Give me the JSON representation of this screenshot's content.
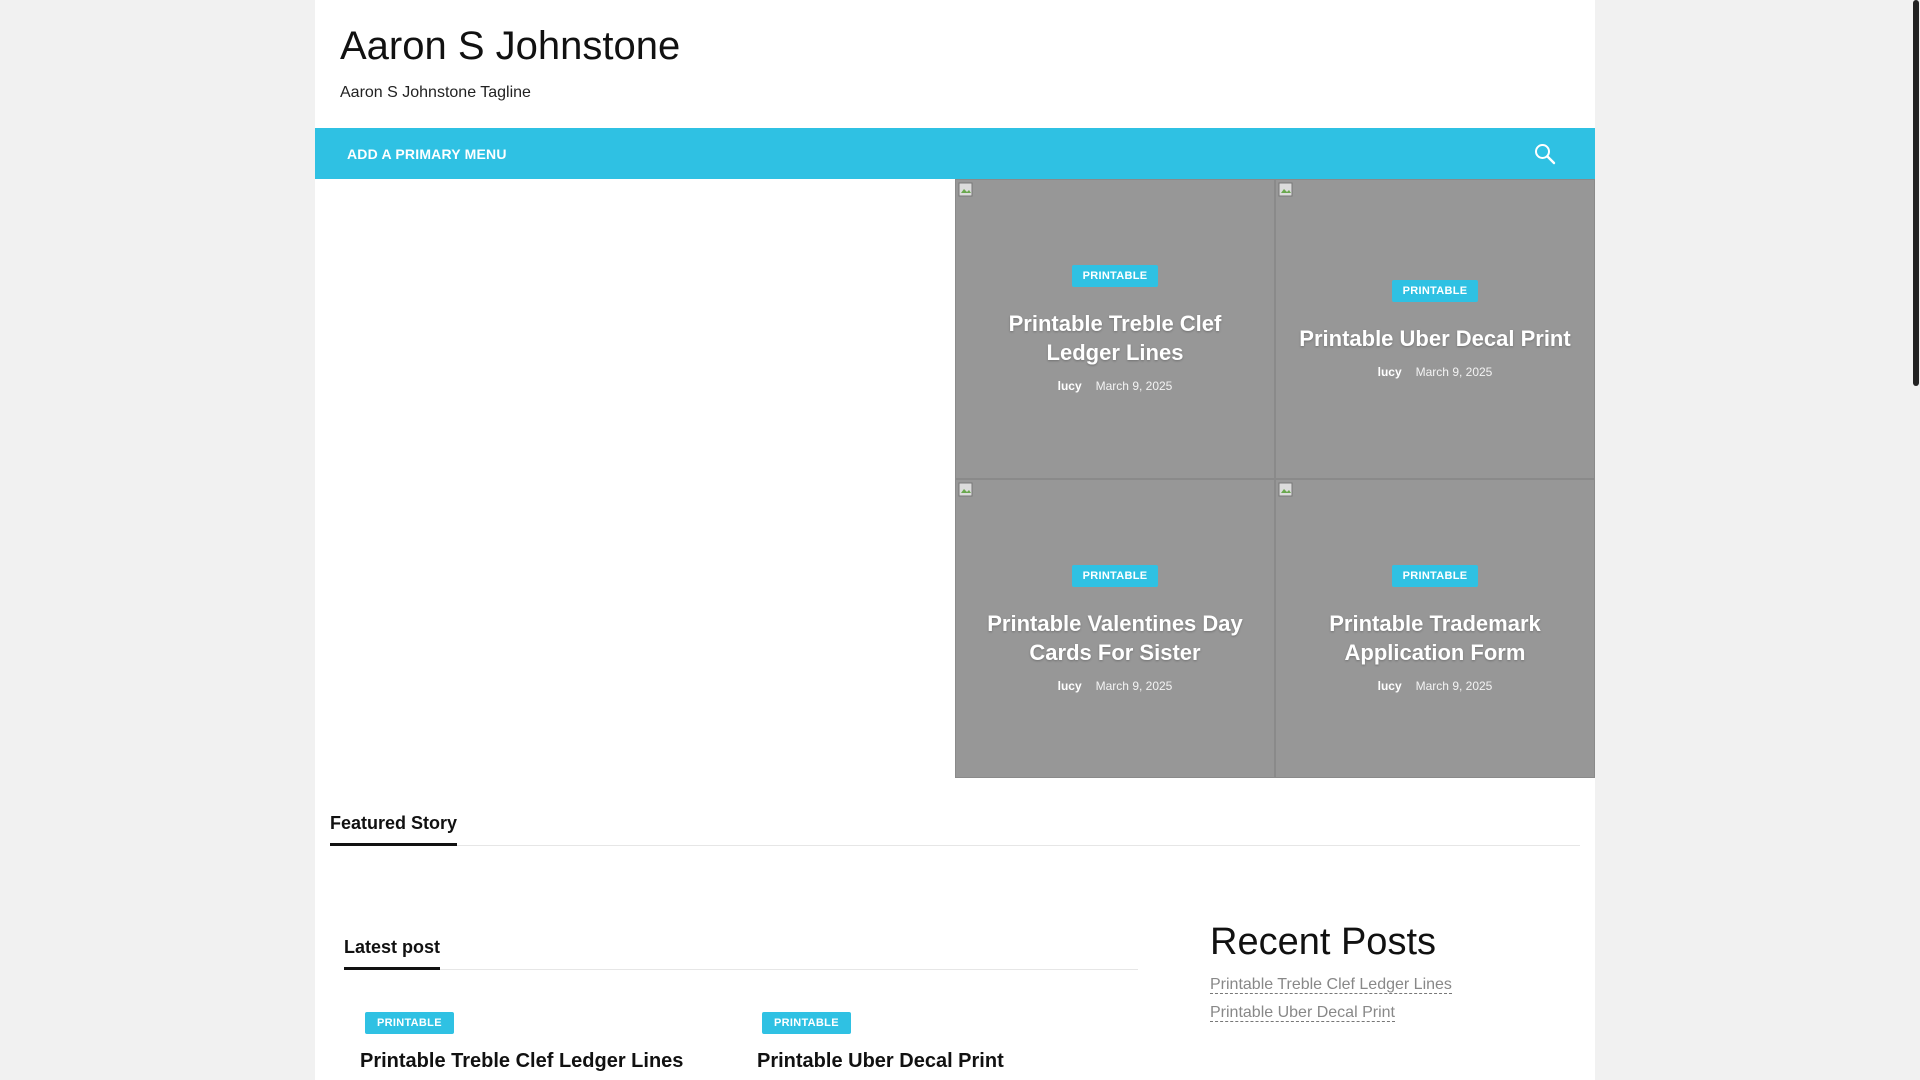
{
  "site": {
    "title": "Aaron S Johnstone",
    "tagline": "Aaron S Johnstone Tagline"
  },
  "nav": {
    "primary_menu_label": "ADD A PRIMARY MENU",
    "search_icon": "search-icon"
  },
  "hero_tiles": [
    {
      "category": "PRINTABLE",
      "title": "Printable Treble Clef Ledger Lines",
      "author": "lucy",
      "date": "March 9, 2025"
    },
    {
      "category": "PRINTABLE",
      "title": "Printable Uber Decal Print",
      "author": "lucy",
      "date": "March 9, 2025"
    },
    {
      "category": "PRINTABLE",
      "title": "Printable Valentines Day Cards For Sister",
      "author": "lucy",
      "date": "March 9, 2025"
    },
    {
      "category": "PRINTABLE",
      "title": "Printable Trademark Application Form",
      "author": "lucy",
      "date": "March 9, 2025"
    }
  ],
  "featured": {
    "heading": "Featured Story"
  },
  "latest": {
    "heading": "Latest post",
    "posts": [
      {
        "category": "PRINTABLE",
        "title": "Printable Treble Clef Ledger Lines"
      },
      {
        "category": "PRINTABLE",
        "title": "Printable Uber Decal Print"
      }
    ]
  },
  "sidebar": {
    "recent_posts_heading": "Recent Posts",
    "recent_posts": [
      "Printable Treble Clef Ledger Lines",
      "Printable Uber Decal Print"
    ]
  },
  "colors": {
    "accent": "#2fc1e3",
    "tile_bg": "#979797"
  }
}
